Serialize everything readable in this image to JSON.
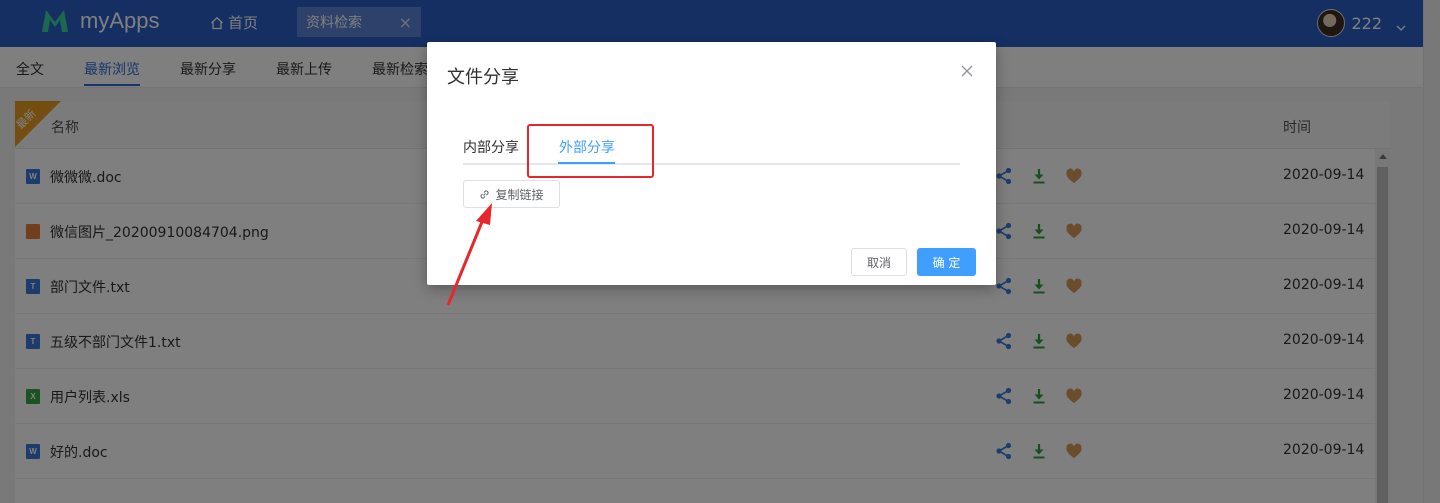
{
  "app": {
    "title": "myApps"
  },
  "nav": {
    "home_label": "首页",
    "active_tab_label": "资料检索",
    "tab_close": "×"
  },
  "user": {
    "name": "222"
  },
  "subnav": {
    "items": [
      {
        "label": "全文"
      },
      {
        "label": "最新浏览"
      },
      {
        "label": "最新分享"
      },
      {
        "label": "最新上传"
      },
      {
        "label": "最新检索"
      }
    ],
    "active_index": 1
  },
  "table": {
    "ribbon_label": "最新",
    "headers": {
      "name": "名称",
      "time": "时间"
    },
    "rows": [
      {
        "name": "微微微.doc",
        "type": "word",
        "type_glyph": "W",
        "date": "2020-09-14"
      },
      {
        "name": "微信图片_20200910084704.png",
        "type": "image",
        "type_glyph": "",
        "date": "2020-09-14"
      },
      {
        "name": "部门文件.txt",
        "type": "text",
        "type_glyph": "T",
        "date": "2020-09-14"
      },
      {
        "name": "五级不部门文件1.txt",
        "type": "text",
        "type_glyph": "T",
        "date": "2020-09-14"
      },
      {
        "name": "用户列表.xls",
        "type": "excel",
        "type_glyph": "X",
        "date": "2020-09-14"
      },
      {
        "name": "好的.doc",
        "type": "word",
        "type_glyph": "W",
        "date": "2020-09-14"
      }
    ],
    "actions": [
      "share-icon",
      "download-icon",
      "heart-icon"
    ]
  },
  "modal": {
    "title": "文件分享",
    "tabs": [
      {
        "label": "内部分享"
      },
      {
        "label": "外部分享"
      }
    ],
    "active_tab": 1,
    "copy_link_label": "复制链接",
    "cancel_label": "取消",
    "confirm_label": "确 定"
  },
  "colors": {
    "topbar": "#2b5fc7",
    "primary": "#409eff",
    "annotation_red": "#e8262b",
    "ribbon": "#e89b23",
    "share": "#3a7bd5",
    "download": "#2e9e3e",
    "heart": "#d49a5a"
  }
}
